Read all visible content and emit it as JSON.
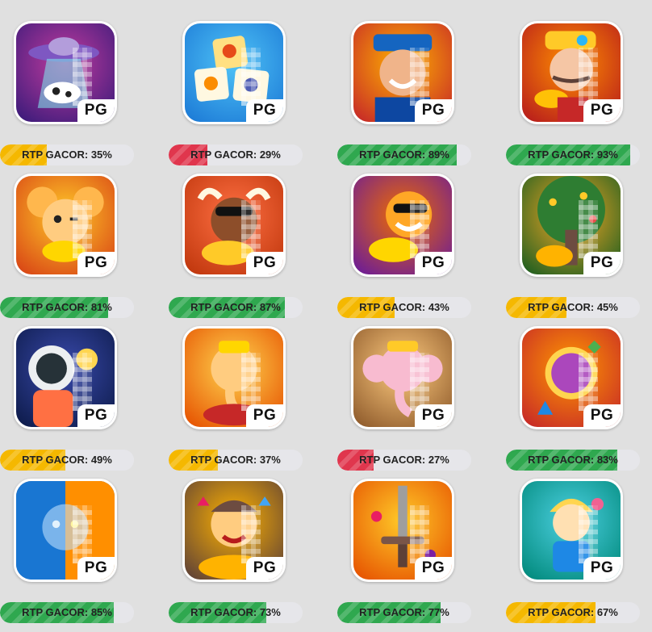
{
  "tile_label": "PG",
  "colors": {
    "green": "#2fa84f",
    "yellow": "#f5b800",
    "red": "#e0364d",
    "track": "#e6e6ea"
  },
  "games": [
    {
      "rtp": 35,
      "rtp_label": "RTP GACOR: 35%",
      "status": "yellow",
      "icon": "ufo-cow-icon",
      "bg": [
        "#3a1b7a",
        "#c23b9e"
      ]
    },
    {
      "rtp": 29,
      "rtp_label": "RTP GACOR: 29%",
      "status": "red",
      "icon": "mahjong-tiles-icon",
      "bg": [
        "#1c7ad6",
        "#4fc3f7"
      ]
    },
    {
      "rtp": 89,
      "rtp_label": "RTP GACOR: 89%",
      "status": "green",
      "icon": "captain-portrait-icon",
      "bg": [
        "#c62828",
        "#ffb300"
      ]
    },
    {
      "rtp": 93,
      "rtp_label": "RTP GACOR: 93%",
      "status": "green",
      "icon": "fortune-god-icon",
      "bg": [
        "#b71c1c",
        "#ff8f00"
      ]
    },
    {
      "rtp": 81,
      "rtp_label": "RTP GACOR: 81%",
      "status": "green",
      "icon": "fortune-mouse-icon",
      "bg": [
        "#d84315",
        "#ffca28"
      ]
    },
    {
      "rtp": 87,
      "rtp_label": "RTP GACOR: 87%",
      "status": "green",
      "icon": "fortune-ox-icon",
      "bg": [
        "#bf360c",
        "#ff7043"
      ]
    },
    {
      "rtp": 43,
      "rtp_label": "RTP GACOR: 43%",
      "status": "yellow",
      "icon": "fortune-tiger-icon",
      "bg": [
        "#6a1b9a",
        "#ef6c00"
      ]
    },
    {
      "rtp": 45,
      "rtp_label": "RTP GACOR: 45%",
      "status": "yellow",
      "icon": "money-tree-icon",
      "bg": [
        "#1b5e20",
        "#f9a825"
      ]
    },
    {
      "rtp": 49,
      "rtp_label": "RTP GACOR: 49%",
      "status": "yellow",
      "icon": "astronaut-icon",
      "bg": [
        "#0d1b4a",
        "#3949ab"
      ]
    },
    {
      "rtp": 37,
      "rtp_label": "RTP GACOR: 37%",
      "status": "yellow",
      "icon": "ganesha-gold-icon",
      "bg": [
        "#e65100",
        "#ffd54f"
      ]
    },
    {
      "rtp": 27,
      "rtp_label": "RTP GACOR: 27%",
      "status": "red",
      "icon": "ganesha-elephant-icon",
      "bg": [
        "#8e5a2b",
        "#ffcc80"
      ]
    },
    {
      "rtp": 83,
      "rtp_label": "RTP GACOR: 83%",
      "status": "green",
      "icon": "purple-gem-icon",
      "bg": [
        "#c62828",
        "#ff9800"
      ]
    },
    {
      "rtp": 85,
      "rtp_label": "RTP GACOR: 85%",
      "status": "green",
      "icon": "fire-ice-face-icon",
      "bg": [
        "#1565c0",
        "#ff6f00"
      ]
    },
    {
      "rtp": 73,
      "rtp_label": "RTP GACOR: 73%",
      "status": "green",
      "icon": "treasure-boy-icon",
      "bg": [
        "#5d4037",
        "#ffb300"
      ]
    },
    {
      "rtp": 77,
      "rtp_label": "RTP GACOR: 77%",
      "status": "green",
      "icon": "sword-icon",
      "bg": [
        "#e65100",
        "#ffca28"
      ]
    },
    {
      "rtp": 67,
      "rtp_label": "RTP GACOR: 67%",
      "status": "yellow",
      "icon": "blonde-hero-icon",
      "bg": [
        "#00897b",
        "#4dd0e1"
      ]
    }
  ]
}
